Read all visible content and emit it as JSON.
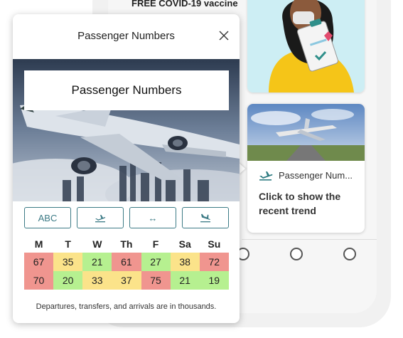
{
  "background": {
    "covid_text": "FREE COVID-19 vaccine",
    "card": {
      "title": "Passenger Num...",
      "description": "Click to show the recent trend"
    }
  },
  "popup": {
    "title": "Passenger Numbers",
    "hero_label": "Passenger Numbers",
    "buttons": [
      {
        "label": "ABC",
        "icon": "text-icon"
      },
      {
        "label": "",
        "icon": "airplane-departure-icon"
      },
      {
        "label": "↔",
        "icon": "transfer-arrows-icon"
      },
      {
        "label": "",
        "icon": "airplane-arrival-icon"
      }
    ],
    "days": [
      "M",
      "T",
      "W",
      "Th",
      "F",
      "Sa",
      "Su"
    ],
    "rows": [
      [
        67,
        35,
        21,
        61,
        27,
        38,
        72
      ],
      [
        70,
        20,
        33,
        37,
        75,
        21,
        19
      ]
    ],
    "footnote": "Departures, transfers, and arrivals are in thousands."
  },
  "colors": {
    "accent": "#3d7b86",
    "high": "#f0958f",
    "medium": "#fbe38a",
    "low": "#b6f090"
  }
}
